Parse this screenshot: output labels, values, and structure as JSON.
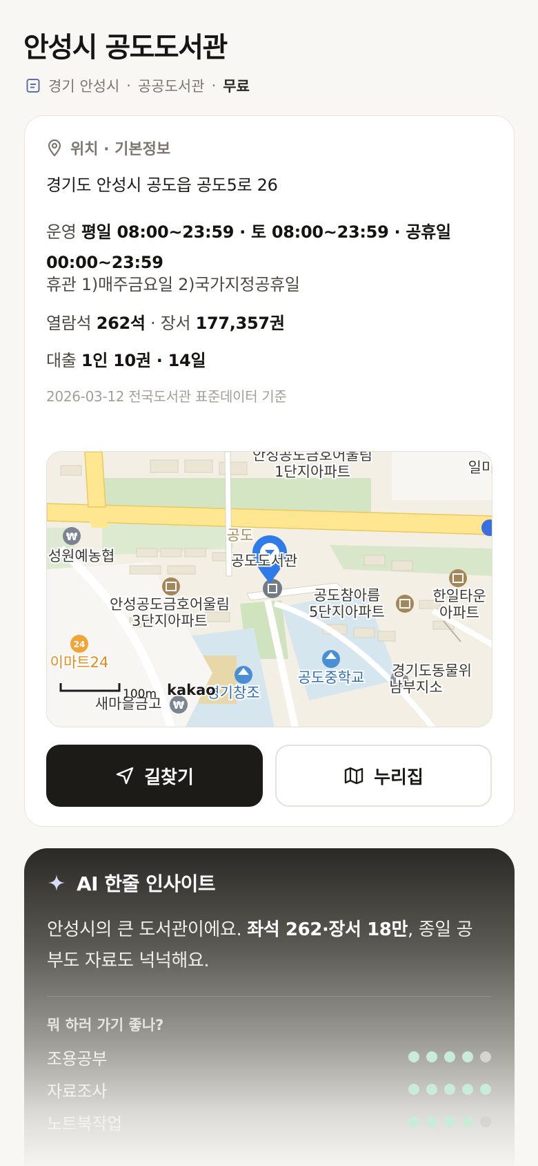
{
  "header": {
    "title": "안성시 공도도서관",
    "region": "경기 안성시",
    "type": "공공도서관",
    "fee": "무료"
  },
  "info": {
    "section_title": "위치 · 기본정보",
    "address": "경기도 안성시 공도읍 공도5로 26",
    "hours_label": "운영",
    "hours": "평일 08:00~23:59 · 토 08:00~23:59 · 공휴일 00:00~23:59",
    "closed_label": "휴관",
    "closed": "1)매주금요일 2)국가지정공휴일",
    "seats_label": "열람석",
    "seats": "262석",
    "books_label": "장서",
    "books": "177,357권",
    "loan_label": "대출",
    "loan": "1인 10권 · 14일",
    "source": "2026-03-12 전국도서관 표준데이터 기준"
  },
  "map": {
    "labels": {
      "apt1a": "안성공도금호어울림",
      "apt1b": "1단지아파트",
      "corner_top": "일미",
      "nonghyup": "성원예농협",
      "gongdo_partial": "공도",
      "library": "공도도서관",
      "apt3a": "안성공도금호어울림",
      "apt3b": "3단지아파트",
      "apt5a": "공도참아름",
      "apt5b": "5단지아파트",
      "hanil_a": "한일타운",
      "hanil_b": "아파트",
      "emart": "이마트24",
      "school": "공도중학교",
      "changjo": "경기창조",
      "animal_a": "경기도동물위",
      "animal_b": "남부지소",
      "saemaeul": "새마을금고",
      "scale": "100m",
      "brand": "kakao"
    }
  },
  "actions": {
    "route_label": "길찾기",
    "site_label": "누리집"
  },
  "ai": {
    "title": "AI 한줄 인사이트",
    "text_prefix": "안성시의 큰 도서관이에요. ",
    "text_bold": "좌석 262·장서 18만",
    "text_suffix": ", 종일 공부도 자료도 넉넉해요.",
    "question": "뭐 하러 가기 좋나?",
    "ratings": [
      {
        "label": "조용공부",
        "score": 4,
        "max": 5
      },
      {
        "label": "자료조사",
        "score": 5,
        "max": 5
      },
      {
        "label": "노트북작업",
        "score": 4,
        "max": 5
      }
    ]
  }
}
